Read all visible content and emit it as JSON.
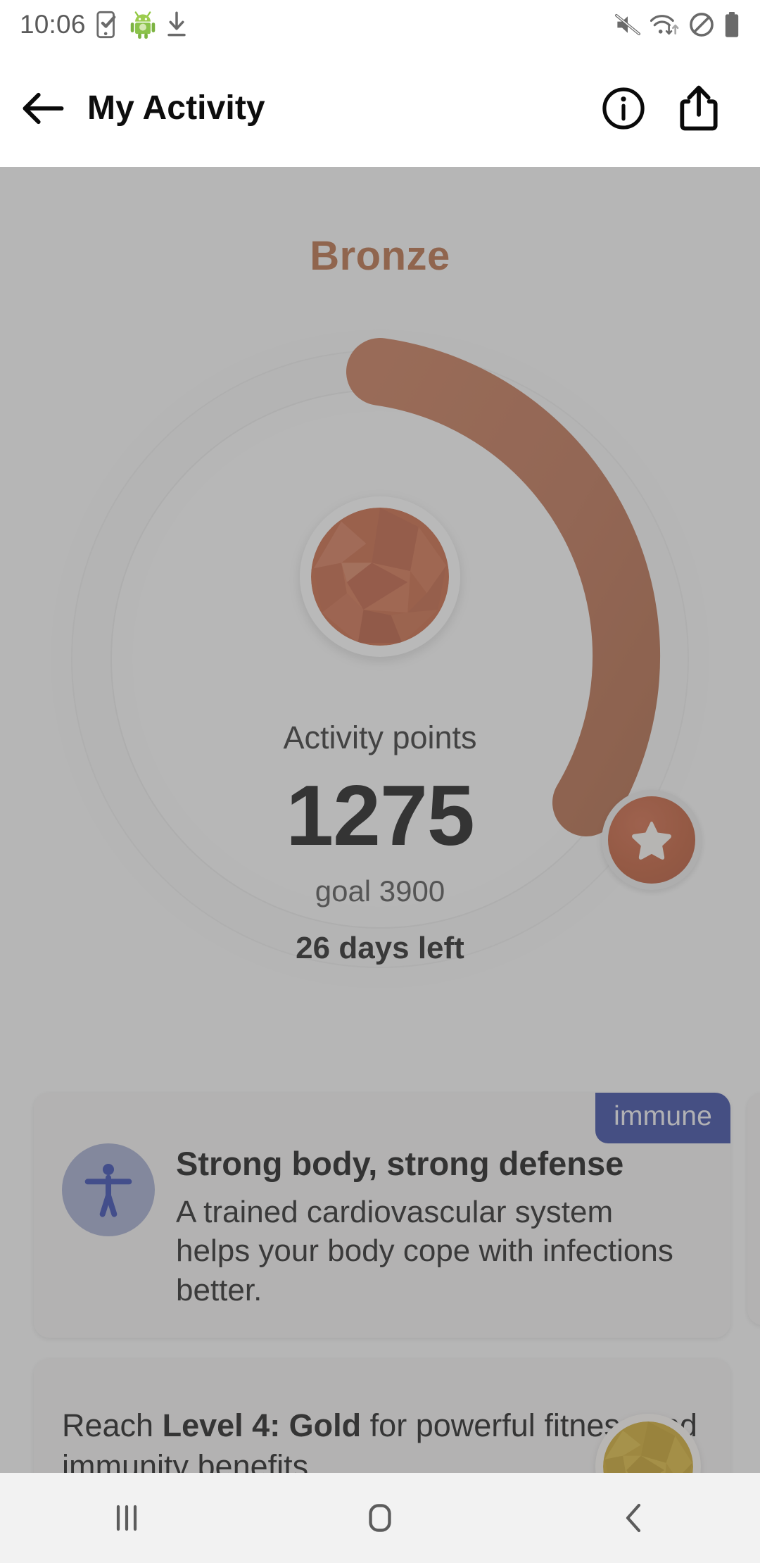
{
  "status_bar": {
    "time": "10:06",
    "left_icons": [
      "phone-check-icon",
      "android-robot-icon",
      "download-icon"
    ],
    "right_icons": [
      "mute-icon",
      "wifi-transfer-icon",
      "do-not-disturb-icon",
      "battery-icon"
    ]
  },
  "app_bar": {
    "back_label": "back-arrow",
    "title": "My Activity",
    "info_label": "info",
    "share_label": "share"
  },
  "progress": {
    "level_name": "Bronze",
    "points_label": "Activity points",
    "points_value": "1275",
    "goal_text": "goal 3900",
    "days_left": "26 days left",
    "points": 1275,
    "goal": 3900,
    "percent": 33,
    "level_color": "#b0673f",
    "arc_color": "#b2694a",
    "gem_color": "#c4603c"
  },
  "cards": [
    {
      "badge": "immune",
      "badge_color": "#30409a",
      "icon": "accessibility-person-icon",
      "icon_color": "#2b3fa8",
      "title": "Strong body, strong defense",
      "text": "A trained cardiovascular system helps your body cope with infections better."
    }
  ],
  "next_level_card": {
    "prefix": "Reach ",
    "highlight": "Level 4: Gold",
    "suffix": " for powerful",
    "second_line": "fitness and immunity benefits",
    "gem": "gold-gem-icon",
    "gem_color": "#c8a328"
  },
  "nav_bar": {
    "recents_label": "recents",
    "home_label": "home",
    "back_label": "back"
  }
}
